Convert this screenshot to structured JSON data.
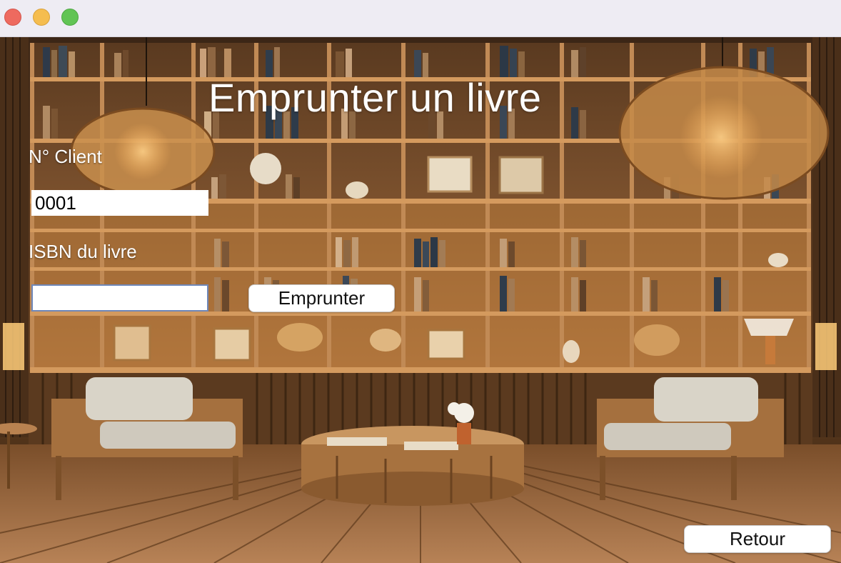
{
  "window": {
    "controls": [
      "close",
      "minimize",
      "maximize"
    ]
  },
  "page": {
    "title": "Emprunter un livre"
  },
  "form": {
    "client_label": "N° Client",
    "client_value": "0001",
    "isbn_label": "ISBN du livre",
    "isbn_value": "",
    "borrow_button": "Emprunter"
  },
  "footer": {
    "back_button": "Retour"
  },
  "colors": {
    "traffic_red": "#ee6a5f",
    "traffic_yellow": "#f5bd4f",
    "traffic_green": "#61c454",
    "field_focus_border": "#6f87b8"
  }
}
